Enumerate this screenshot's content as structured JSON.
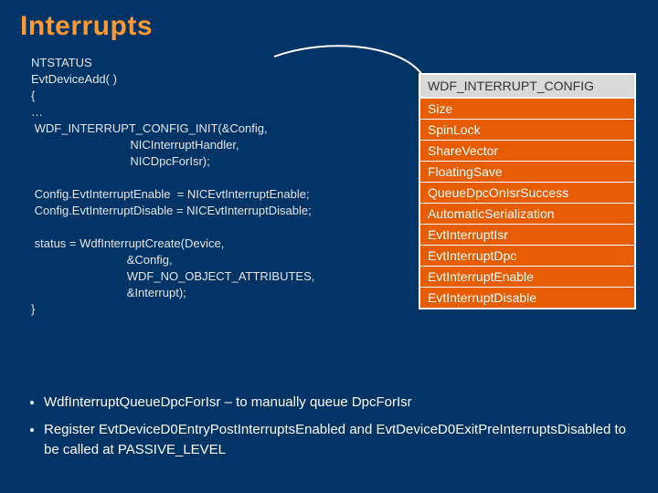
{
  "title": "Interrupts",
  "code": "NTSTATUS\nEvtDeviceAdd( )\n{\n…\n WDF_INTERRUPT_CONFIG_INIT(&Config,\n                              NICInterruptHandler,\n                              NICDpcForIsr);\n\n Config.EvtInterruptEnable  = NICEvtInterruptEnable;\n Config.EvtInterruptDisable = NICEvtInterruptDisable;\n\n status = WdfInterruptCreate(Device,\n                             &Config,\n                             WDF_NO_OBJECT_ATTRIBUTES,\n                             &Interrupt);\n}",
  "table": {
    "header": "WDF_INTERRUPT_CONFIG",
    "rows": [
      "Size",
      "SpinLock",
      "ShareVector",
      "FloatingSave",
      "QueueDpcOnIsrSuccess",
      "AutomaticSerialization",
      "EvtInterruptIsr",
      "EvtInterruptDpc",
      "EvtInterruptEnable",
      "EvtInterruptDisable"
    ]
  },
  "bullets": [
    "WdfInterruptQueueDpcForIsr – to manually queue DpcForIsr",
    "Register EvtDeviceD0EntryPostInterruptsEnabled and EvtDeviceD0ExitPreInterruptsDisabled to be called at PASSIVE_LEVEL"
  ]
}
